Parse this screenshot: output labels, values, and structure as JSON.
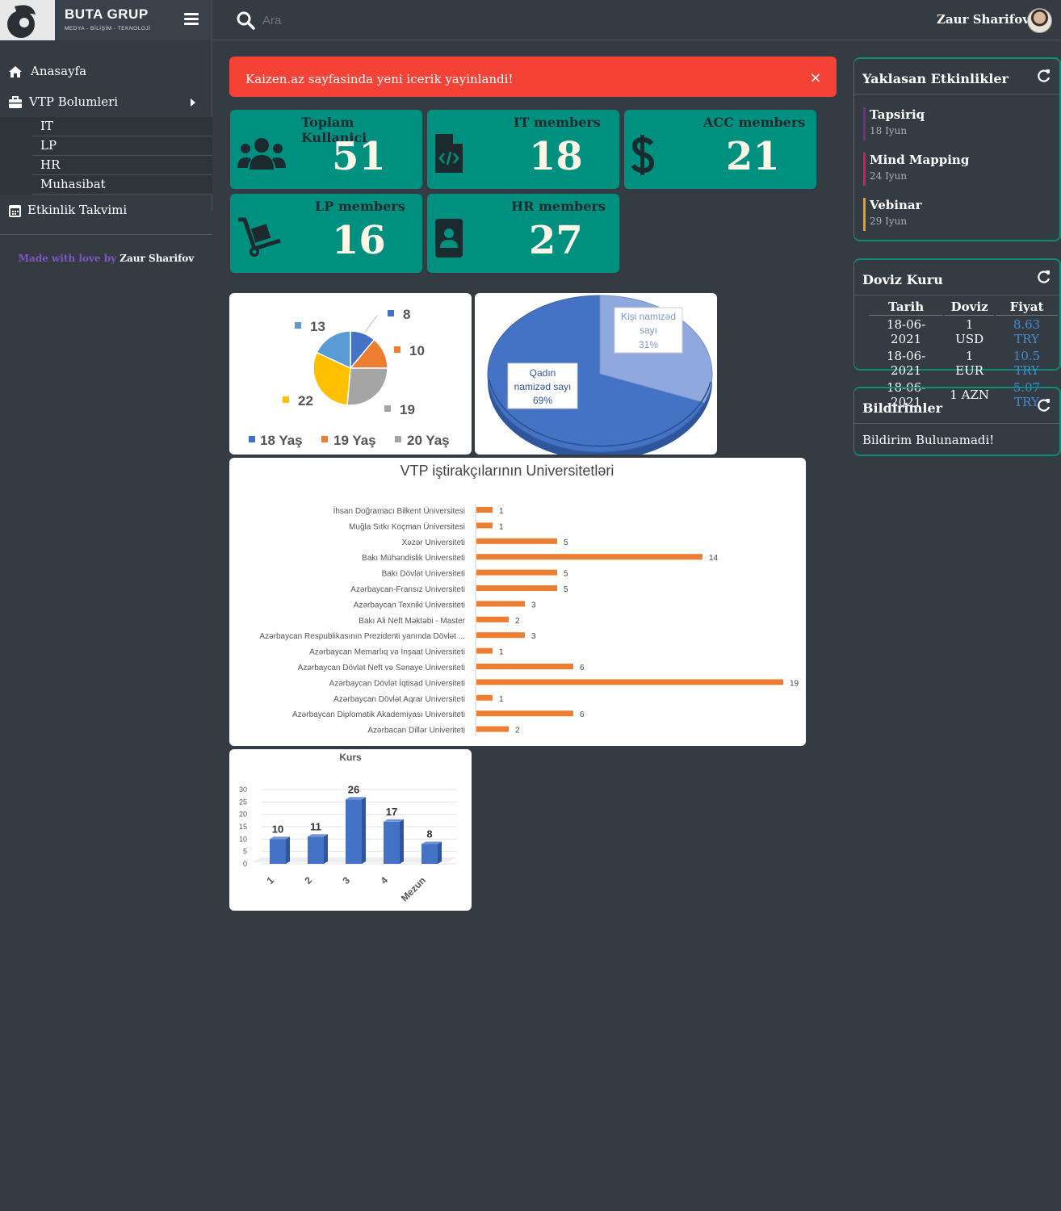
{
  "header": {
    "brand_title": "BUTA GRUP",
    "brand_subtitle": "MEDYA - BİLİŞİM - TEKNOLOJİ",
    "search_placeholder": "Ara",
    "user_name": "Zaur Sharifov"
  },
  "sidebar": {
    "home": "Anasayfa",
    "vtp_sections": "VTP Bolumleri",
    "submenu": [
      "IT",
      "LP",
      "HR",
      "Muhasibat"
    ],
    "calendar": "Etkinlik Takvimi",
    "footer_prefix": "Made with love by",
    "footer_name": "Zaur Sharifov"
  },
  "alert": {
    "text": "Kaizen.az sayfasinda yeni icerik yayinlandi!",
    "close": "×"
  },
  "stats": [
    {
      "title": "Toplam Kullanici",
      "value": "51",
      "icon": "users-icon"
    },
    {
      "title": "IT members",
      "value": "18",
      "icon": "file-code-icon"
    },
    {
      "title": "ACC members",
      "value": "21",
      "icon": "dollar-icon"
    },
    {
      "title": "LP members",
      "value": "16",
      "icon": "dolly-icon"
    },
    {
      "title": "HR members",
      "value": "27",
      "icon": "id-badge-icon"
    }
  ],
  "chart_data": [
    {
      "type": "pie",
      "title": "",
      "values": [
        8,
        10,
        19,
        22,
        13
      ],
      "colors": [
        "#4472c4",
        "#ed7d31",
        "#a5a5a5",
        "#ffc000",
        "#5b9bd5"
      ],
      "legend": [
        "18 Yaş",
        "19 Yaş",
        "20 Yaş"
      ],
      "legend_colors": [
        "#4472c4",
        "#ed7d31",
        "#a5a5a5"
      ],
      "legend_position": "bottom"
    },
    {
      "type": "pie",
      "title": "",
      "slices": [
        {
          "label": "Qadın namizəd sayı",
          "percent": 69
        },
        {
          "label": "Kişi namizəd sayı",
          "percent": 31
        }
      ],
      "label_lines": {
        "female": [
          "Qadın",
          "namizəd sayı",
          "69%"
        ],
        "male": [
          "Kişi namizəd",
          "sayı",
          "31%"
        ]
      }
    },
    {
      "type": "bar",
      "orientation": "horizontal",
      "title": "VTP iştirakçılarının Universitetləri",
      "color": "#ed7d31",
      "categories": [
        "İhsan Doğramacı Bilkent Üniversitesi",
        "Muğla Sıtkı Koçman Üniversitesi",
        "Xəzər Universiteti",
        "Bakı Mühəndislik Universiteti",
        "Bakı Dövlət Universiteti",
        "Azərbaycan-Fransız Universiteti",
        "Azərbaycan Texniki Universiteti",
        "Bakı Ali Neft Məktəbi - Master",
        "Azərbaycan Respublikasının Prezidenti yanında Dövlət ...",
        "Azərbaycan Memarlıq və İnşaat Universiteti",
        "Azərbaycan Dövlət Neft və Sənaye Universiteti",
        "Azərbaycan Dövlət İqtisad Universiteti",
        "Azərbaycan Dövlət Aqrar Universiteti",
        "Azərbaycan Diplomatik Akademiyası Universiteti",
        "Azərbacan Dillər Univeriteti"
      ],
      "values": [
        1,
        1,
        5,
        14,
        5,
        5,
        3,
        2,
        3,
        1,
        6,
        19,
        1,
        6,
        2
      ]
    },
    {
      "type": "bar",
      "title": "Kurs",
      "color": "#4472c4",
      "categories": [
        "1",
        "2",
        "3",
        "4",
        "Mezun"
      ],
      "values": [
        10,
        11,
        26,
        17,
        8
      ],
      "yticks": [
        "0",
        "5",
        "10",
        "15",
        "20",
        "25",
        "30"
      ],
      "ylim": [
        0,
        30
      ]
    }
  ],
  "events": {
    "title": "Yaklasan Etkinlikler",
    "items": [
      {
        "title": "Tapsiriq",
        "date": "18 Iyun",
        "color": "#7b2c8b"
      },
      {
        "title": "Mind Mapping",
        "date": "24 Iyun",
        "color": "#d81b60"
      },
      {
        "title": "Vebinar",
        "date": "29 Iyun",
        "color": "#f39c12"
      }
    ]
  },
  "currency": {
    "title": "Doviz Kuru",
    "headers": [
      "Tarih",
      "Doviz",
      "Fiyat"
    ],
    "rows": [
      [
        "18-06-2021",
        "1 USD",
        "8.63 TRY"
      ],
      [
        "18-06-2021",
        "1 EUR",
        "10.5 TRY"
      ],
      [
        "18-06-2021",
        "1 AZN",
        "5.07 TRY"
      ]
    ]
  },
  "notifications": {
    "title": "Bildirimler",
    "empty_text": "Bildirim Bulunamadi!"
  }
}
